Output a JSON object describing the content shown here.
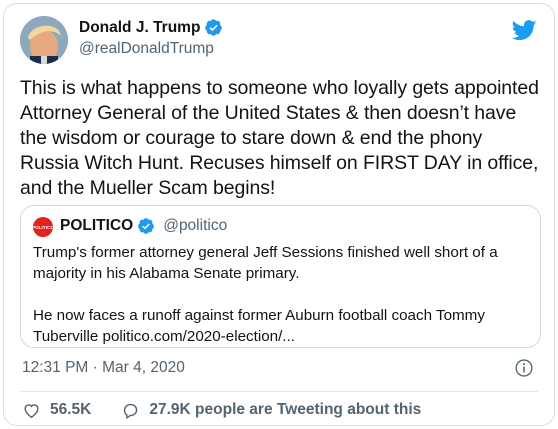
{
  "author": {
    "name": "Donald J. Trump",
    "handle": "@realDonaldTrump",
    "verified": true
  },
  "tweet": {
    "text": "This is what happens to someone who loyally gets appointed\nAttorney General of the United States & then doesn’t have\nthe wisdom or courage to stare down & end the phony\nRussia Witch Hunt. Recuses himself on FIRST DAY in office,\nand the Mueller Scam begins!",
    "timestamp": "12:31 PM · Mar 4, 2020"
  },
  "quoted_tweet": {
    "avatar_text": "POLITICO",
    "name": "POLITICO",
    "handle": "@politico",
    "paragraph1": "Trump's former attorney general Jeff Sessions finished well short of a majority in his Alabama Senate primary.",
    "paragraph2": "He now faces a runoff against former Auburn football coach Tommy Tuberville politico.com/2020-election/..."
  },
  "actions": {
    "likes": "56.5K",
    "tweeting": "27.9K people are Tweeting about this"
  },
  "colors": {
    "twitter_blue": "#1d9bf0",
    "politico_red": "#e0241b",
    "secondary_text": "#536471"
  },
  "icons": [
    "verified-badge-icon",
    "twitter-bird-icon",
    "info-icon",
    "heart-icon",
    "comment-icon"
  ]
}
